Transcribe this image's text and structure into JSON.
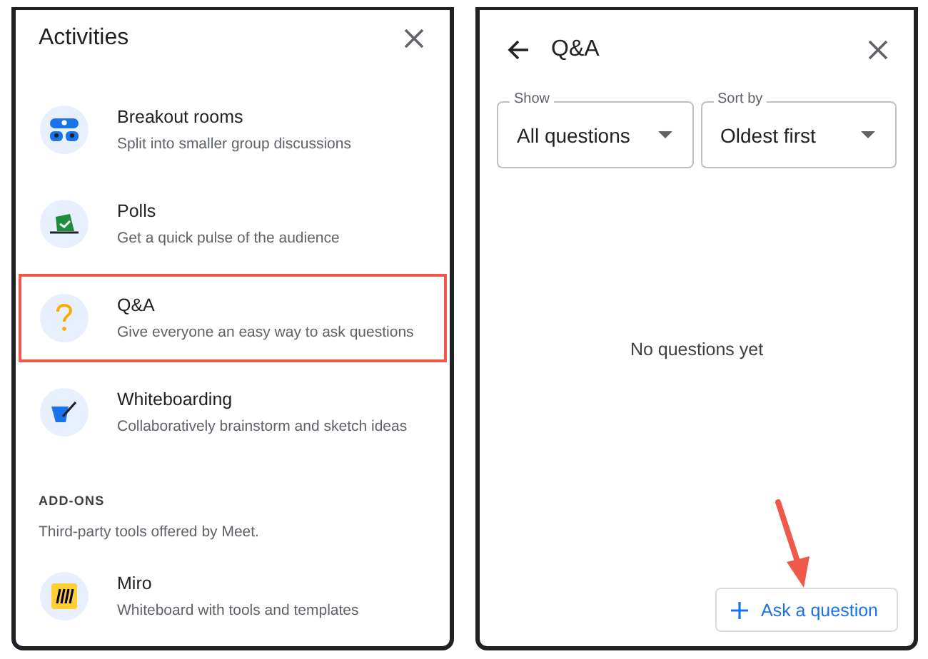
{
  "activities_panel": {
    "title": "Activities",
    "items": [
      {
        "kind": "breakout",
        "title": "Breakout rooms",
        "description": "Split into smaller group discussions",
        "highlighted": false
      },
      {
        "kind": "polls",
        "title": "Polls",
        "description": "Get a quick pulse of the audience",
        "highlighted": false
      },
      {
        "kind": "qa",
        "title": "Q&A",
        "description": "Give everyone an easy way to ask questions",
        "highlighted": true
      },
      {
        "kind": "whiteboard",
        "title": "Whiteboarding",
        "description": "Collaboratively brainstorm and sketch ideas",
        "highlighted": false
      }
    ],
    "addons_heading": "ADD-ONS",
    "addons_note": "Third-party tools offered by Meet.",
    "addons": [
      {
        "kind": "miro",
        "title": "Miro",
        "description": "Whiteboard with tools and templates",
        "highlighted": false
      }
    ]
  },
  "qa_panel": {
    "title": "Q&A",
    "filters": [
      {
        "label": "Show",
        "value": "All questions"
      },
      {
        "label": "Sort by",
        "value": "Oldest first"
      }
    ],
    "empty_message": "No questions yet",
    "ask_button": {
      "label": "Ask a question",
      "pointed": true
    }
  }
}
